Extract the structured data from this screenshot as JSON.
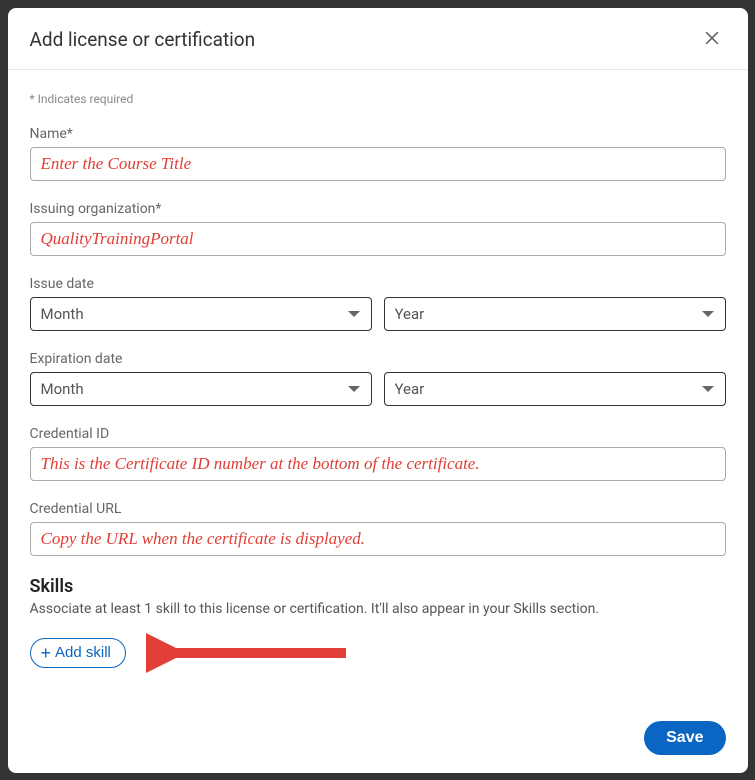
{
  "header": {
    "title": "Add license or certification"
  },
  "requiredNote": "* Indicates required",
  "fields": {
    "name": {
      "label": "Name*",
      "value": "Enter the Course Title"
    },
    "issuingOrg": {
      "label": "Issuing organization*",
      "value": "QualityTrainingPortal"
    },
    "issueDate": {
      "label": "Issue date",
      "month": "Month",
      "year": "Year"
    },
    "expirationDate": {
      "label": "Expiration date",
      "month": "Month",
      "year": "Year"
    },
    "credentialId": {
      "label": "Credential ID",
      "value": "This is the Certificate ID number at the bottom of the certificate."
    },
    "credentialUrl": {
      "label": "Credential URL",
      "value": "Copy the URL when the certificate is displayed."
    }
  },
  "skills": {
    "heading": "Skills",
    "description": "Associate at least 1 skill to this license or certification. It'll also appear in your Skills section.",
    "addButton": "Add skill"
  },
  "footer": {
    "saveButton": "Save"
  }
}
